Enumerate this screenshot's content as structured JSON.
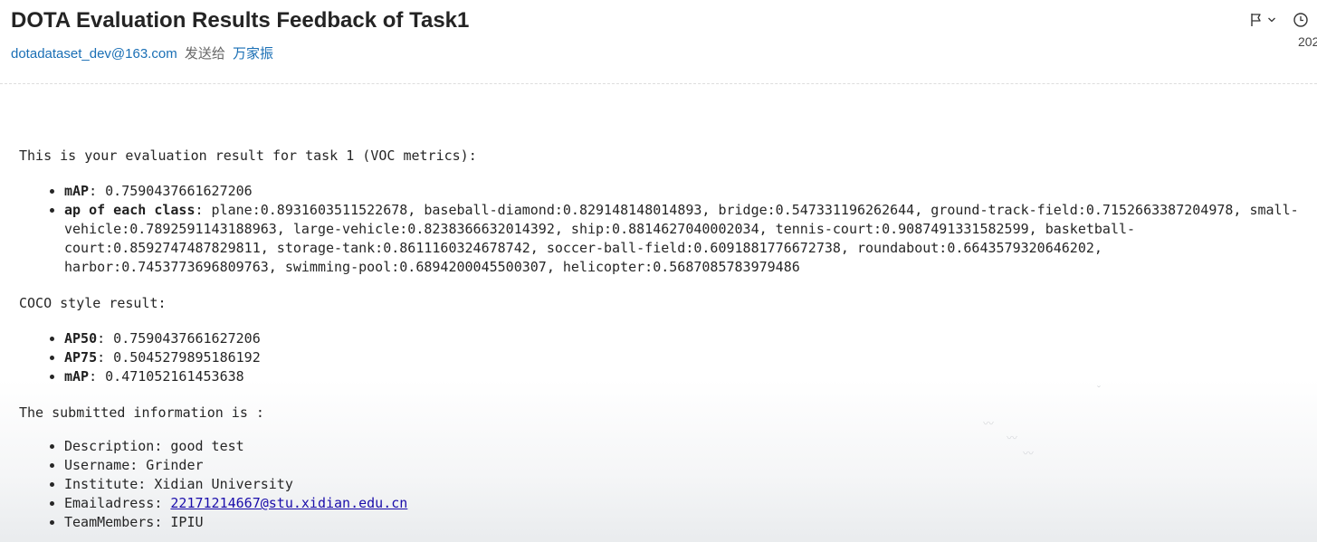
{
  "email": {
    "subject": "DOTA Evaluation Results Feedback of Task1",
    "sender": "dotadataset_dev@163.com",
    "sent_to_label": "发送给",
    "recipient": "万家振",
    "date_fragment": "202",
    "flag_icon": "flag-icon",
    "clock_icon": "clock-icon"
  },
  "body": {
    "intro": "This is your evaluation result for task 1 (VOC metrics):",
    "voc": {
      "map_label": "mAP",
      "map_value": ": 0.7590437661627206",
      "ap_label": "ap of each class",
      "ap_value": ": plane:0.8931603511522678, baseball-diamond:0.829148148014893, bridge:0.547331196262644, ground-track-field:0.7152663387204978, small-vehicle:0.7892591143188963, large-vehicle:0.8238366632014392, ship:0.8814627040002034, tennis-court:0.9087491331582599, basketball-court:0.8592747487829811, storage-tank:0.8611160324678742, soccer-ball-field:0.6091881776672738, roundabout:0.6643579320646202, harbor:0.7453773696809763, swimming-pool:0.6894200045500307, helicopter:0.5687085783979486"
    },
    "coco_heading": "COCO style result:",
    "coco": [
      {
        "label": "AP50",
        "value": ": 0.7590437661627206"
      },
      {
        "label": "AP75",
        "value": ": 0.5045279895186192"
      },
      {
        "label": "mAP",
        "value": ": 0.471052161453638"
      }
    ],
    "submitted_heading": "The submitted information is :",
    "submitted": {
      "description": "Description: good test",
      "username": "Username: Grinder",
      "institute": "Institute: Xidian University",
      "email_prefix": "Emailadress: ",
      "email_link": "22171214667@stu.xidian.edu.cn",
      "team": "TeamMembers: IPIU"
    }
  }
}
